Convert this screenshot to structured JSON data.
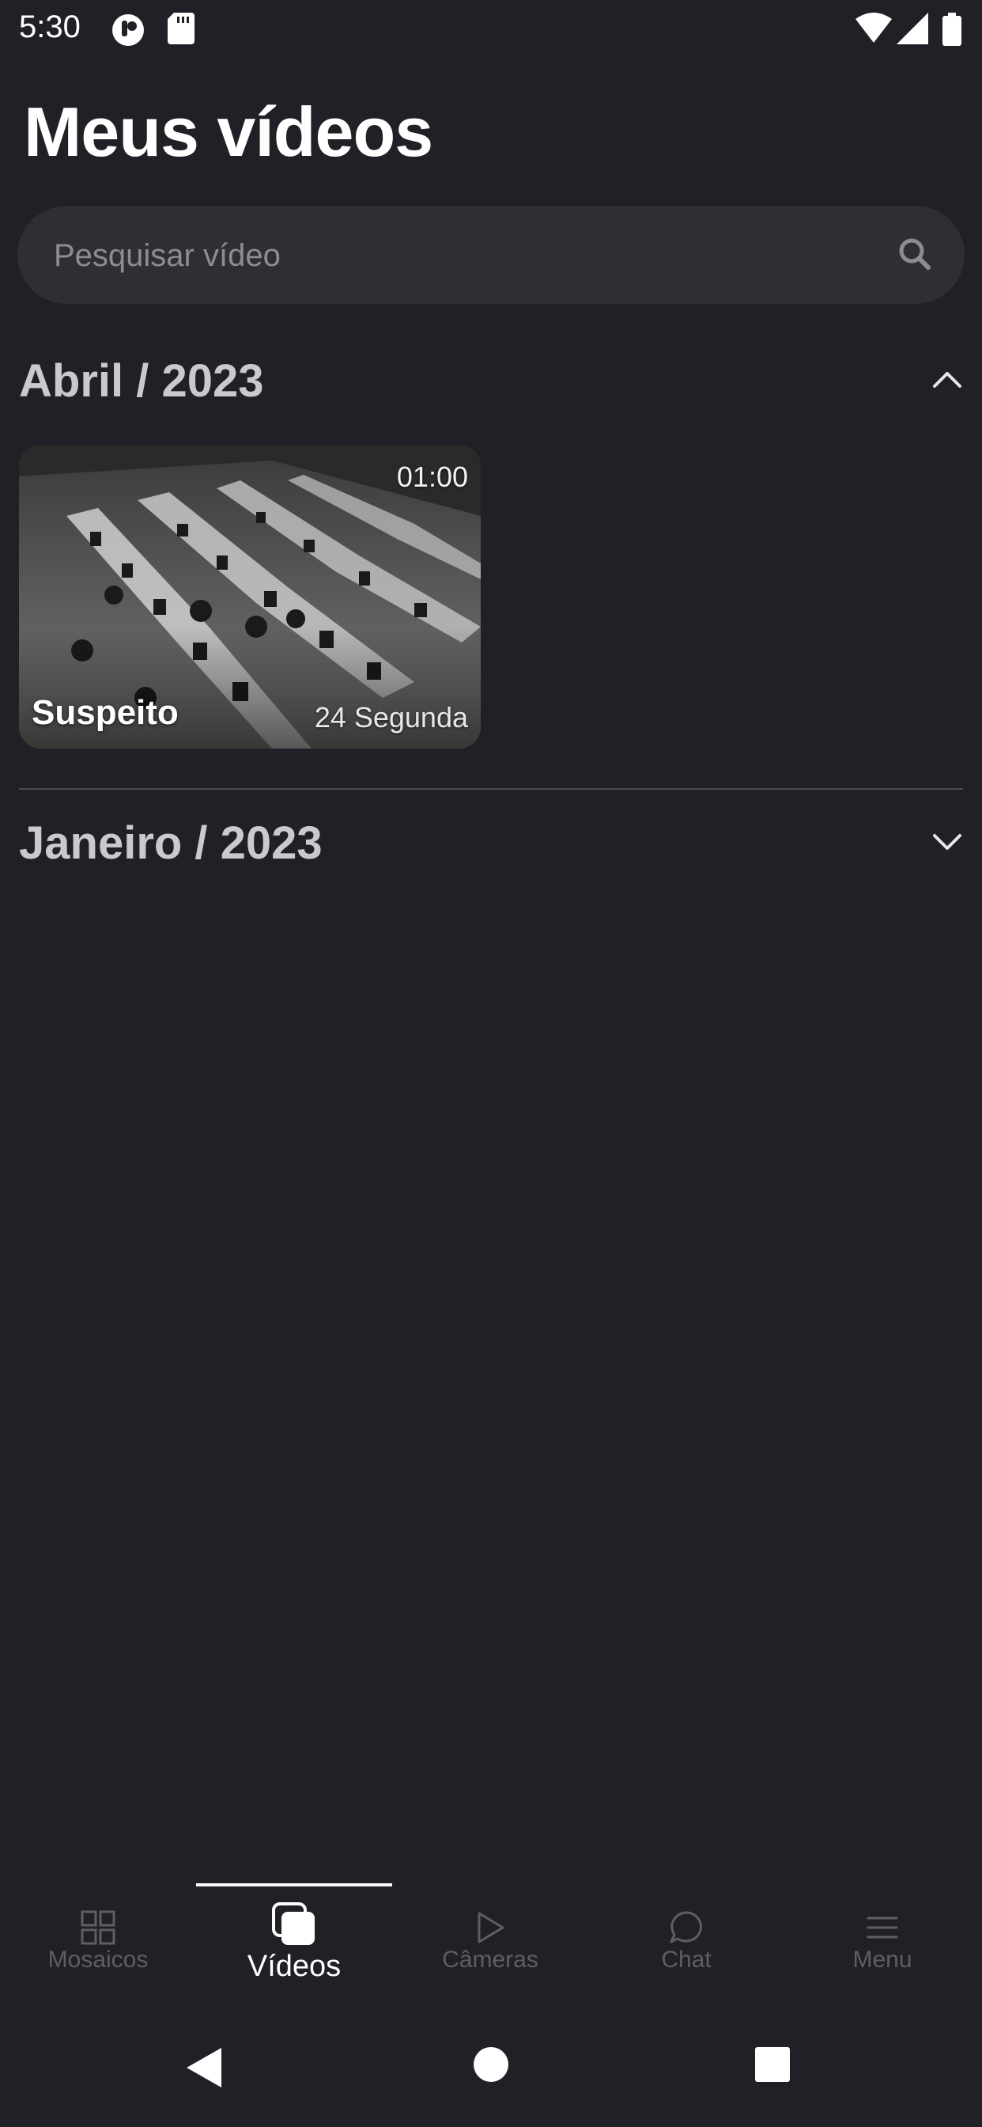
{
  "status_bar": {
    "time": "5:30",
    "left_icons": [
      "app-notification-icon",
      "sd-card-icon"
    ],
    "right_icons": [
      "wifi-icon",
      "signal-icon",
      "battery-icon"
    ]
  },
  "page": {
    "title": "Meus vídeos"
  },
  "search": {
    "placeholder": "Pesquisar vídeo",
    "value": ""
  },
  "sections": [
    {
      "title": "Abril / 2023",
      "expanded": true,
      "videos": [
        {
          "title": "Suspeito",
          "duration": "01:00",
          "date": "24 Segunda"
        }
      ]
    },
    {
      "title": "Janeiro / 2023",
      "expanded": false,
      "videos": []
    }
  ],
  "bottom_nav": {
    "active": "Vídeos",
    "items": [
      {
        "label": "Mosaicos",
        "icon": "grid-icon"
      },
      {
        "label": "Vídeos",
        "icon": "videos-icon"
      },
      {
        "label": "Câmeras",
        "icon": "play-icon"
      },
      {
        "label": "Chat",
        "icon": "chat-bubble-icon"
      },
      {
        "label": "Menu",
        "icon": "menu-icon"
      }
    ]
  },
  "colors": {
    "background": "#202126",
    "search_background": "#2e2f35",
    "section_title": "#c9cacf",
    "inactive_nav": "#5e5f66",
    "active_nav": "#ffffff"
  }
}
